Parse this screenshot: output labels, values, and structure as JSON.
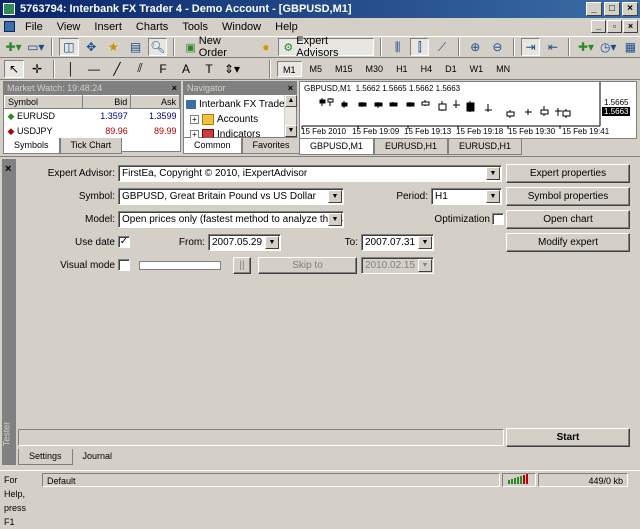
{
  "window": {
    "title": "5763794: Interbank FX Trader 4 - Demo Account - [GBPUSD,M1]"
  },
  "menu": [
    "File",
    "View",
    "Insert",
    "Charts",
    "Tools",
    "Window",
    "Help"
  ],
  "toolbar": {
    "new_order": "New Order",
    "expert_advisors": "Expert Advisors"
  },
  "timeframes": [
    "M1",
    "M5",
    "M15",
    "M30",
    "H1",
    "H4",
    "D1",
    "W1",
    "MN"
  ],
  "market_watch": {
    "title": "Market Watch: 19:48:24",
    "columns": [
      "Symbol",
      "Bid",
      "Ask"
    ],
    "rows": [
      {
        "symbol": "EURUSD",
        "bid": "1.3597",
        "ask": "1.3599"
      },
      {
        "symbol": "USDJPY",
        "bid": "89.96",
        "ask": "89.99"
      }
    ],
    "tabs": [
      "Symbols",
      "Tick Chart"
    ]
  },
  "navigator": {
    "title": "Navigator",
    "items": [
      "Interbank FX Trade",
      "Accounts",
      "Indicators"
    ],
    "tabs": [
      "Common",
      "Favorites"
    ]
  },
  "chart": {
    "header": "GBPUSD,M1  1.5662 1.5665 1.5662 1.5663",
    "price_labels": [
      "1.5665",
      "1.5663"
    ],
    "time_labels": [
      "15 Feb 2010",
      "15 Feb 19:09",
      "15 Feb 19:13",
      "15 Feb 19:18",
      "15 Feb 19:30",
      "15 Feb 19:41"
    ],
    "tabs": [
      "GBPUSD,M1",
      "EURUSD,H1",
      "EURUSD,H1"
    ]
  },
  "tester": {
    "side_label": "Tester",
    "expert_label": "Expert Advisor:",
    "expert_value": "FirstEa, Copyright © 2010,  iExpertAdvisor",
    "symbol_label": "Symbol:",
    "symbol_value": "GBPUSD, Great Britain Pound vs US Dollar",
    "period_label": "Period:",
    "period_value": "H1",
    "model_label": "Model:",
    "model_value": "Open prices only (fastest method to analyze the bar ju",
    "optimization_label": "Optimization",
    "use_date_label": "Use date",
    "from_label": "From:",
    "from_value": "2007.05.29",
    "to_label": "To:",
    "to_value": "2007.07.31",
    "visual_mode_label": "Visual mode",
    "pause_label": "||",
    "skip_to_label": "Skip to",
    "skip_date": "2010.02.15",
    "buttons": {
      "expert_properties": "Expert properties",
      "symbol_properties": "Symbol properties",
      "open_chart": "Open chart",
      "modify_expert": "Modify expert",
      "start": "Start"
    },
    "tabs": [
      "Settings",
      "Journal"
    ]
  },
  "status": {
    "help": "For Help, press F1",
    "profile": "Default",
    "traffic": "449/0 kb"
  }
}
